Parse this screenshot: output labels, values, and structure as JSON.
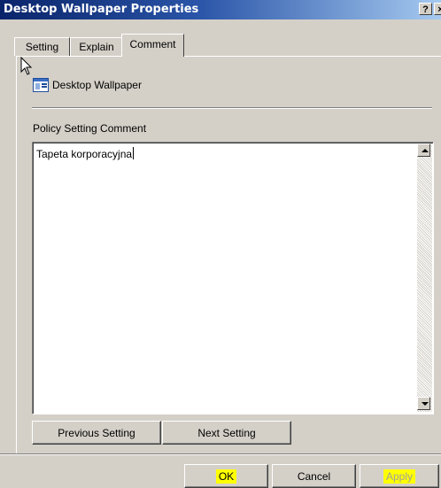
{
  "window": {
    "title": "Desktop Wallpaper Properties",
    "help_label": "?",
    "close_label": "×"
  },
  "tabs": [
    {
      "label": "Setting"
    },
    {
      "label": "Explain"
    },
    {
      "label": "Comment",
      "active": true
    }
  ],
  "policy": {
    "name": "Desktop Wallpaper",
    "icon": "policy-setting-icon"
  },
  "comment": {
    "label": "Policy Setting Comment",
    "value": "Tapeta korporacyjna"
  },
  "navigation": {
    "previous_label": "Previous Setting",
    "next_label": "Next Setting"
  },
  "footer": {
    "ok_label": "OK",
    "cancel_label": "Cancel",
    "apply_label": "Apply",
    "apply_enabled": false
  },
  "colors": {
    "titlebar_start": "#0a246a",
    "titlebar_end": "#a6caf0",
    "dialog_face": "#d4d0c8",
    "highlight": "#ffff00"
  }
}
